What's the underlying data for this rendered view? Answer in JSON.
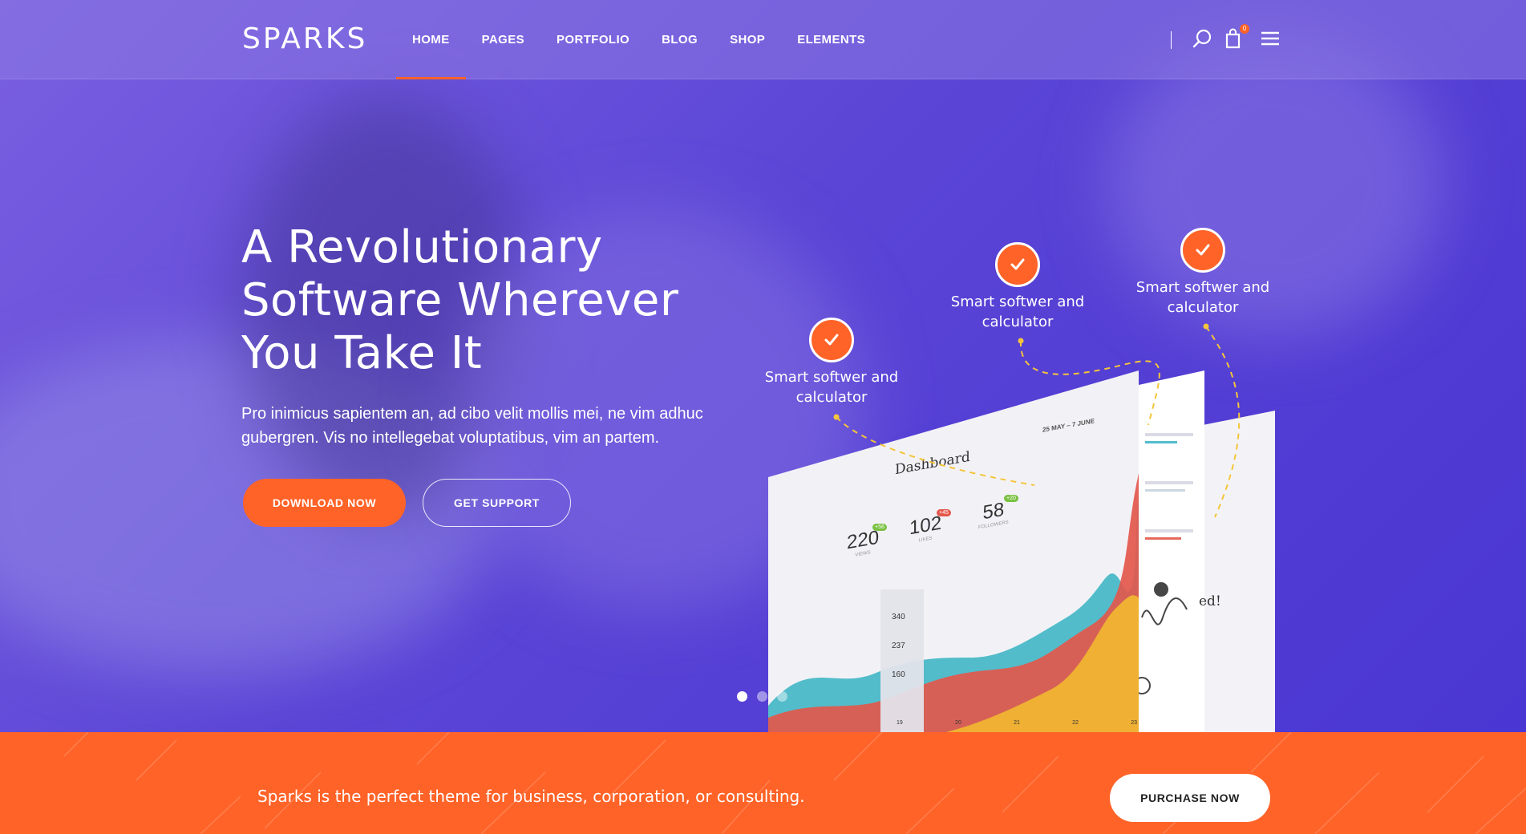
{
  "header": {
    "logo": "SPARKS",
    "nav": [
      "HOME",
      "PAGES",
      "PORTFOLIO",
      "BLOG",
      "SHOP",
      "ELEMENTS"
    ],
    "active_nav": "HOME",
    "cart_count": "0",
    "icons": [
      "search-icon",
      "cart-icon",
      "menu-icon"
    ]
  },
  "hero": {
    "title_line1": "A Revolutionary",
    "title_line2": "Software Wherever",
    "title_line3": "You Take It",
    "description": "Pro inimicus sapientem an, ad cibo velit mollis mei, ne vim adhuc gubergren. Vis no intellegebat voluptatibus, vim an partem.",
    "primary_button": "DOWNLOAD NOW",
    "secondary_button": "GET SUPPORT"
  },
  "features": [
    {
      "label": "Smart softwer and calculator"
    },
    {
      "label": "Smart softwer and calculator"
    },
    {
      "label": "Smart softwer and calculator"
    }
  ],
  "dashboard": {
    "title": "Dashboard",
    "date_range": "25 MAY – 7 JUNE",
    "stats": [
      {
        "value": "220",
        "label": "VIEWS",
        "badge": "+56"
      },
      {
        "value": "102",
        "label": "LIKES",
        "badge": "+45"
      },
      {
        "value": "58",
        "label": "FOLLOWERS",
        "badge": "+20"
      }
    ],
    "tooltip": [
      "340",
      "237",
      "160"
    ],
    "x_ticks": [
      "19",
      "20",
      "21",
      "22",
      "23"
    ],
    "side_text": "ed!"
  },
  "slider": {
    "slides": 3,
    "active": 1
  },
  "cta": {
    "text": "Sparks is the perfect theme for business, corporation, or consulting.",
    "button": "PURCHASE NOW"
  },
  "colors": {
    "accent": "#ff6328",
    "hero_purple": "#5a45d6",
    "white": "#ffffff"
  }
}
